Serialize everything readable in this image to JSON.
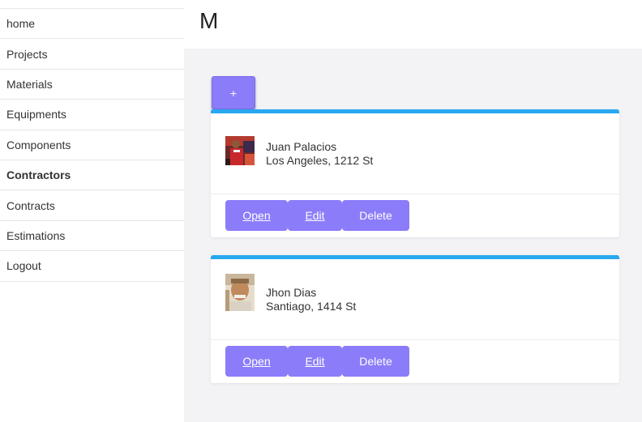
{
  "sidebar": {
    "items": [
      {
        "label": "home",
        "active": false
      },
      {
        "label": "Projects",
        "active": false
      },
      {
        "label": "Materials",
        "active": false
      },
      {
        "label": "Equipments",
        "active": false
      },
      {
        "label": "Components",
        "active": false
      },
      {
        "label": "Contractors",
        "active": true
      },
      {
        "label": "Contracts",
        "active": false
      },
      {
        "label": "Estimations",
        "active": false
      },
      {
        "label": "Logout",
        "active": false
      }
    ]
  },
  "header": {
    "title": "M"
  },
  "main": {
    "add_label": "+",
    "contractors": [
      {
        "name": "Juan Palacios",
        "address": "Los Angeles, 1212 St",
        "open_label": "Open",
        "edit_label": "Edit",
        "delete_label": "Delete"
      },
      {
        "name": "Jhon Dias",
        "address": "Santiago, 1414 St",
        "open_label": "Open",
        "edit_label": "Edit",
        "delete_label": "Delete"
      }
    ]
  },
  "colors": {
    "accent": "#8b7cf9",
    "card_top_border": "#29a8f0",
    "main_background": "#f3f3f6"
  }
}
